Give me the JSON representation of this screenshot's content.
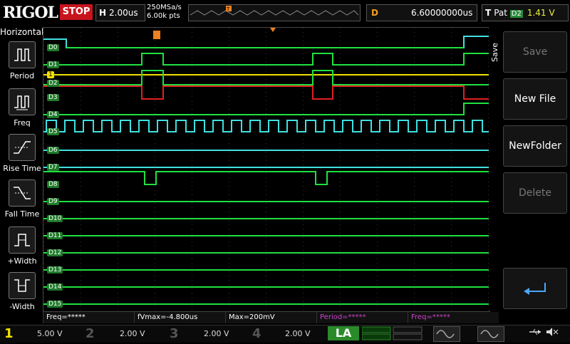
{
  "header": {
    "brand": "RIGOL",
    "run_state": "STOP",
    "timebase_label": "H",
    "timebase_value": "2.00us",
    "sample_rate": "250MSa/s",
    "memory_depth": "6.00k pts",
    "delay_label": "D",
    "delay_value": "6.60000000us",
    "trigger_label": "T",
    "trigger_type": "Pat",
    "trigger_source": "D2",
    "trigger_level": "1.41 V",
    "trigger_marker": "T"
  },
  "left_menu": {
    "title": "Horizontal",
    "items": [
      {
        "label": "Period",
        "icon": "period-measure-icon"
      },
      {
        "label": "Freq",
        "icon": "frequency-measure-icon"
      },
      {
        "label": "Rise Time",
        "icon": "rise-time-icon"
      },
      {
        "label": "Fall Time",
        "icon": "fall-time-icon"
      },
      {
        "label": "+Width",
        "icon": "positive-width-icon"
      },
      {
        "label": "-Width",
        "icon": "negative-width-icon"
      }
    ]
  },
  "channels": {
    "labels": [
      "D0",
      "D1",
      "1",
      "D2",
      "D3",
      "D4",
      "D5",
      "D6",
      "D7",
      "D8",
      "D9",
      "D10",
      "D11",
      "D12",
      "D13",
      "D14",
      "D15"
    ]
  },
  "right_panel": {
    "title": "Save",
    "buttons": [
      {
        "label": "Save",
        "enabled": false
      },
      {
        "label": "New File",
        "enabled": true
      },
      {
        "label": "NewFolder",
        "enabled": true
      },
      {
        "label": "Delete",
        "enabled": false
      }
    ],
    "enter_icon": "enter-return-icon"
  },
  "measurements": [
    {
      "text": "Freq=*****",
      "color": "#ffffff"
    },
    {
      "text": "fVmax=-4.800us",
      "color": "#ffffff"
    },
    {
      "text": "Max=200mV",
      "color": "#ffffff"
    },
    {
      "text": "Period=*****",
      "color": "#cc44cc"
    },
    {
      "text": "Freq=*****",
      "color": "#cc44cc"
    }
  ],
  "bottom_bar": {
    "ch1": {
      "num": "1",
      "value": "5.00 V",
      "color": "#f0e000"
    },
    "ch2": {
      "num": "2",
      "value": "2.00 V",
      "color": "#30c0e0"
    },
    "ch3": {
      "num": "3",
      "value": "2.00 V",
      "color": "#e040e0"
    },
    "ch4": {
      "num": "4",
      "value": "2.00 V",
      "color": "#3080ff"
    },
    "la_label": "LA",
    "usb_icon": "usb-icon",
    "speaker_icon": "speaker-muted-icon"
  },
  "colors": {
    "digital_trace": "#20e040",
    "highlight_trace": "#40e0e0",
    "red_trace": "#e02020",
    "ch1_trace": "#f0e000",
    "stop_bg": "#c8141c",
    "trigger_marker": "#f08020"
  }
}
